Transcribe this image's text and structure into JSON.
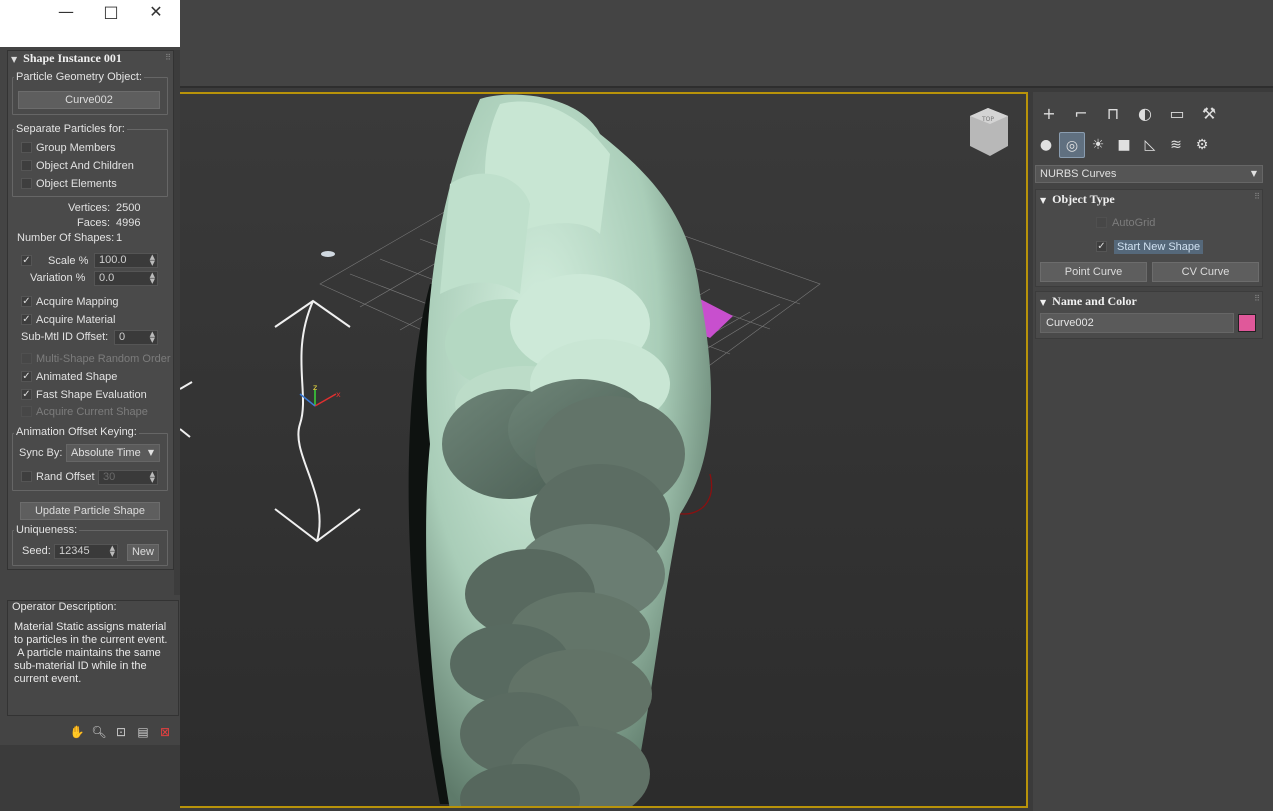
{
  "colors": {
    "accent_active": "#b8930a",
    "object_color": "#e0589a",
    "mesh_color": "#c8e6d3",
    "plane_color": "#c84fce"
  },
  "window_controls": [
    "minimize-icon",
    "maximize-icon",
    "close-icon"
  ],
  "shape_instance": {
    "title": "Shape Instance 001",
    "particle_geometry": {
      "label": "Particle Geometry Object:",
      "button": "Curve002"
    },
    "separate": {
      "label": "Separate Particles for:",
      "options": [
        {
          "label": "Group Members",
          "checked": false
        },
        {
          "label": "Object And Children",
          "checked": false
        },
        {
          "label": "Object Elements",
          "checked": false
        }
      ]
    },
    "stats": {
      "vertices_label": "Vertices:",
      "vertices": "2500",
      "faces_label": "Faces:",
      "faces": "4996",
      "shapes_label": "Number Of Shapes:",
      "shapes": "1"
    },
    "scale": {
      "label": "Scale %",
      "value": "100.0",
      "checked": true
    },
    "variation": {
      "label": "Variation %",
      "value": "0.0"
    },
    "acquire_mapping": {
      "label": "Acquire Mapping",
      "checked": true
    },
    "acquire_material": {
      "label": "Acquire Material",
      "checked": true
    },
    "submtl": {
      "label": "Sub-Mtl ID Offset:",
      "value": "0"
    },
    "multi_shape": {
      "label": "Multi-Shape Random Order",
      "checked": false,
      "disabled": true
    },
    "animated_shape": {
      "label": "Animated Shape",
      "checked": true
    },
    "fast_eval": {
      "label": "Fast Shape Evaluation",
      "checked": true
    },
    "acquire_current": {
      "label": "Acquire Current Shape",
      "checked": false,
      "disabled": true
    },
    "anim_offset": {
      "label": "Animation Offset Keying:",
      "sync_label": "Sync By:",
      "sync_value": "Absolute Time",
      "rand_label": "Rand Offset",
      "rand_value": "30"
    },
    "update_button": "Update Particle Shape",
    "uniqueness": {
      "label": "Uniqueness:",
      "seed_label": "Seed:",
      "seed_value": "12345",
      "new_button": "New"
    }
  },
  "operator_description": {
    "title": "Operator Description:",
    "text": "Material Static assigns material\nto particles in the current event.\n A particle maintains the same\nsub-material ID while in the\ncurrent event."
  },
  "bottom_tools": [
    "hand-icon",
    "zoom-icon",
    "zoom-region-icon",
    "display-icon",
    "delete-icon"
  ],
  "viewport": {
    "viewcube_label": "TOP"
  },
  "command_panel": {
    "tabs": [
      "create-icon",
      "modify-icon",
      "hierarchy-icon",
      "motion-icon",
      "display-icon",
      "utilities-icon"
    ],
    "tab_glyphs": [
      "+",
      "⌐",
      "⊓",
      "◐",
      "▭",
      "⚒"
    ],
    "subcategories": [
      "geometry-icon",
      "shapes-icon",
      "lights-icon",
      "cameras-icon",
      "helpers-icon",
      "spacewarps-icon",
      "systems-icon"
    ],
    "sub_glyphs": [
      "●",
      "◎",
      "☀",
      "■",
      "◺",
      "≋",
      "⚙"
    ],
    "category": "NURBS Curves",
    "object_type": {
      "title": "Object Type",
      "autogrid": {
        "label": "AutoGrid",
        "checked": false,
        "disabled": true
      },
      "start_new_shape": {
        "label": "Start New Shape",
        "checked": true
      },
      "buttons": [
        "Point Curve",
        "CV Curve"
      ]
    },
    "name_color": {
      "title": "Name and Color",
      "name": "Curve002"
    }
  }
}
